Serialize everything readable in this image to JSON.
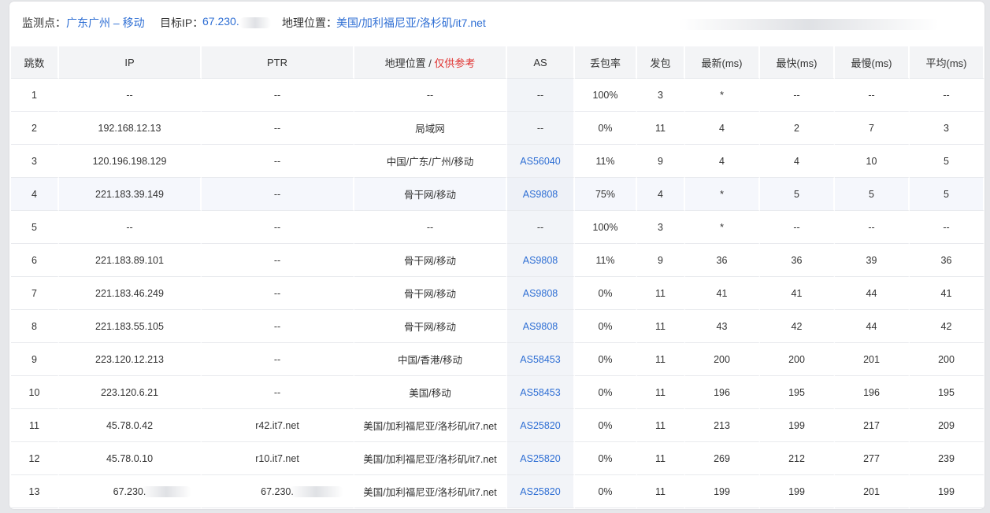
{
  "header": {
    "monitor_label": "监测点：",
    "monitor_value": "广东广州 – 移动",
    "target_label": "目标IP：",
    "target_value": "67.230.",
    "geo_label": "地理位置：",
    "geo_value": "美国/加利福尼亚/洛杉矶/it7.net"
  },
  "table": {
    "columns": {
      "hop": "跳数",
      "ip": "IP",
      "ptr": "PTR",
      "geo": "地理位置",
      "geo_sep": " / ",
      "geo_note": "仅供参考",
      "as": "AS",
      "loss": "丢包率",
      "sent": "发包",
      "last": "最新(ms)",
      "best": "最快(ms)",
      "worst": "最慢(ms)",
      "avg": "平均(ms)"
    },
    "rows": [
      {
        "hop": "1",
        "ip": "--",
        "ptr": "--",
        "geo": "--",
        "as": "--",
        "loss": "100%",
        "sent": "3",
        "last": "*",
        "best": "--",
        "worst": "--",
        "avg": "--"
      },
      {
        "hop": "2",
        "ip": "192.168.12.13",
        "ptr": "--",
        "geo": "局域网",
        "as": "--",
        "loss": "0%",
        "sent": "11",
        "last": "4",
        "best": "2",
        "worst": "7",
        "avg": "3"
      },
      {
        "hop": "3",
        "ip": "120.196.198.129",
        "ptr": "--",
        "geo": "中国/广东/广州/移动",
        "as": "AS56040",
        "loss": "11%",
        "sent": "9",
        "last": "4",
        "best": "4",
        "worst": "10",
        "avg": "5"
      },
      {
        "hop": "4",
        "ip": "221.183.39.149",
        "ptr": "--",
        "geo": "骨干网/移动",
        "as": "AS9808",
        "loss": "75%",
        "sent": "4",
        "last": "*",
        "best": "5",
        "worst": "5",
        "avg": "5"
      },
      {
        "hop": "5",
        "ip": "--",
        "ptr": "--",
        "geo": "--",
        "as": "--",
        "loss": "100%",
        "sent": "3",
        "last": "*",
        "best": "--",
        "worst": "--",
        "avg": "--"
      },
      {
        "hop": "6",
        "ip": "221.183.89.101",
        "ptr": "--",
        "geo": "骨干网/移动",
        "as": "AS9808",
        "loss": "11%",
        "sent": "9",
        "last": "36",
        "best": "36",
        "worst": "39",
        "avg": "36"
      },
      {
        "hop": "7",
        "ip": "221.183.46.249",
        "ptr": "--",
        "geo": "骨干网/移动",
        "as": "AS9808",
        "loss": "0%",
        "sent": "11",
        "last": "41",
        "best": "41",
        "worst": "44",
        "avg": "41"
      },
      {
        "hop": "8",
        "ip": "221.183.55.105",
        "ptr": "--",
        "geo": "骨干网/移动",
        "as": "AS9808",
        "loss": "0%",
        "sent": "11",
        "last": "43",
        "best": "42",
        "worst": "44",
        "avg": "42"
      },
      {
        "hop": "9",
        "ip": "223.120.12.213",
        "ptr": "--",
        "geo": "中国/香港/移动",
        "as": "AS58453",
        "loss": "0%",
        "sent": "11",
        "last": "200",
        "best": "200",
        "worst": "201",
        "avg": "200"
      },
      {
        "hop": "10",
        "ip": "223.120.6.21",
        "ptr": "--",
        "geo": "美国/移动",
        "as": "AS58453",
        "loss": "0%",
        "sent": "11",
        "last": "196",
        "best": "195",
        "worst": "196",
        "avg": "195"
      },
      {
        "hop": "11",
        "ip": "45.78.0.42",
        "ptr": "r42.it7.net",
        "geo": "美国/加利福尼亚/洛杉矶/it7.net",
        "as": "AS25820",
        "loss": "0%",
        "sent": "11",
        "last": "213",
        "best": "199",
        "worst": "217",
        "avg": "209"
      },
      {
        "hop": "12",
        "ip": "45.78.0.10",
        "ptr": "r10.it7.net",
        "geo": "美国/加利福尼亚/洛杉矶/it7.net",
        "as": "AS25820",
        "loss": "0%",
        "sent": "11",
        "last": "269",
        "best": "212",
        "worst": "277",
        "avg": "239"
      },
      {
        "hop": "13",
        "ip": "67.230.",
        "ptr": "67.230.",
        "geo": "美国/加利福尼亚/洛杉矶/it7.net",
        "as": "AS25820",
        "loss": "0%",
        "sent": "11",
        "last": "199",
        "best": "199",
        "worst": "201",
        "avg": "199"
      }
    ]
  },
  "colors": {
    "link": "#2f6fd4",
    "warning": "#e0312f",
    "header_bg": "#f3f4f6",
    "highlight_row": "#f5f7fc"
  }
}
